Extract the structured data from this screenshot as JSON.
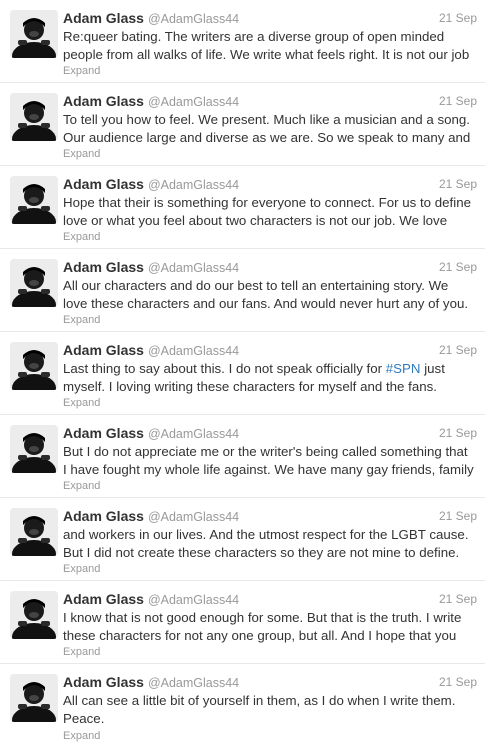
{
  "author": {
    "name": "Adam Glass",
    "handle": "@AdamGlass44",
    "avatar_icon": "user-avatar-icon"
  },
  "expand_label": "Expand",
  "tweets": [
    {
      "time": "21 Sep",
      "lines": [
        "Re:queer bating. The writers are a diverse group of open minded",
        "people from all walks of life. We write what feels right. It is not our job"
      ]
    },
    {
      "time": "21 Sep",
      "lines": [
        "To tell you how to feel. We present. Much like a musician and a song.",
        "Our audience large and diverse as we are. So we speak to many and"
      ]
    },
    {
      "time": "21 Sep",
      "lines": [
        "Hope that their is something for everyone to connect. For us to define",
        "love or what you feel about two characters is not our job. We love"
      ]
    },
    {
      "time": "21 Sep",
      "lines": [
        "All our characters and do our best to tell an entertaining story. We",
        "love these characters and our fans. And would never hurt any of you."
      ]
    },
    {
      "time": "21 Sep",
      "line1_pre": "Last thing to say about this. I do not speak officially for ",
      "hashtag": "#SPN",
      "line1_post": " just",
      "lines": [
        "",
        "myself. I loving writing these characters for myself and the fans."
      ]
    },
    {
      "time": "21 Sep",
      "lines": [
        "But I do not appreciate me or the writer's being called something that",
        "I have fought my whole life against. We have many gay friends, family"
      ]
    },
    {
      "time": "21 Sep",
      "lines": [
        "and workers in our lives. And the utmost respect for the LGBT cause.",
        "But I did not create these characters so they are not mine to define."
      ]
    },
    {
      "time": "21 Sep",
      "lines": [
        "I know that is not good enough for some. But that is the truth. I write",
        "these characters for not any one group, but all. And I hope that you"
      ]
    },
    {
      "time": "21 Sep",
      "lines": [
        "All can see a little bit of yourself in them, as I do when I write them.",
        "Peace."
      ]
    }
  ]
}
